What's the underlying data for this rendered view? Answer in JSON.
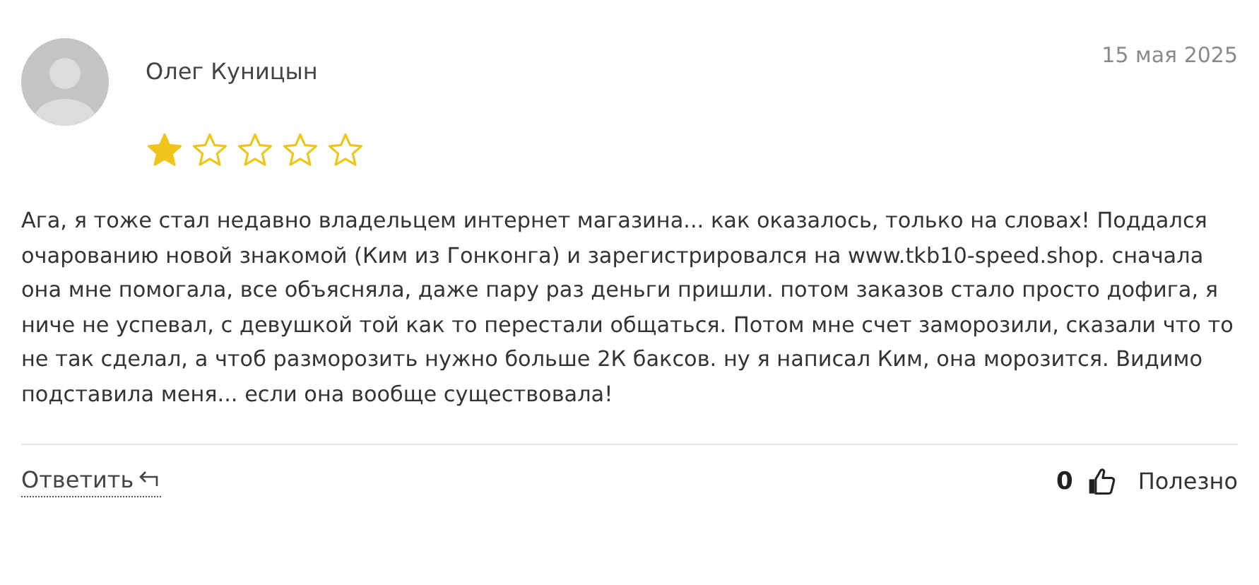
{
  "review": {
    "author": "Олег Куницын",
    "date": "15 мая 2025",
    "stars": 1,
    "text": "Ага, я тоже стал недавно владельцем интернет магазина... как оказалось, только на словах! Поддался очарованию новой знакомой (Ким из Гонконга) и зарегистрировался на www.tkb10-speed.shop. сначала она мне помогала, все объясняла, даже пару раз деньги пришли. потом заказов стало просто дофига, я ниче не успевал, с девушкой той как то перестали общаться. Потом мне счет заморозили, сказали что то не так сделал, а чтоб разморозить нужно больше 2К баксов. ну я написал Ким, она морозится. Видимо подставила меня... если она вообще существовала!"
  },
  "footer": {
    "reply": "Ответить",
    "likes": "0",
    "helpful": "Полезно"
  }
}
